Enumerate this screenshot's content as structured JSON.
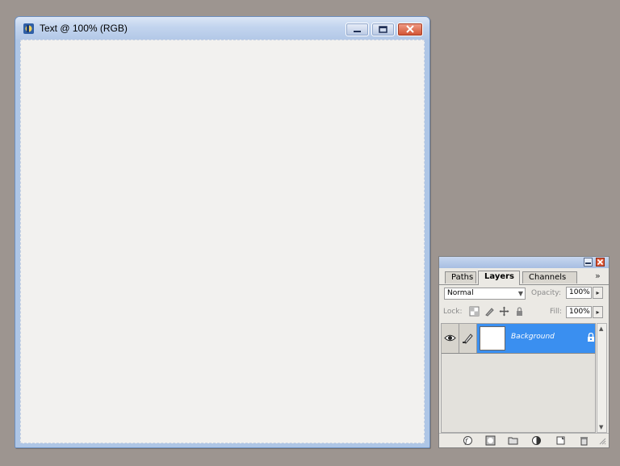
{
  "document_window": {
    "title": "Text @ 100% (RGB)",
    "icons": [
      "photoshop-app-icon",
      "minimize-icon",
      "maximize-icon",
      "close-icon"
    ]
  },
  "layers_palette": {
    "tabs": [
      {
        "label": "Paths",
        "active": false
      },
      {
        "label": "Layers",
        "active": true
      },
      {
        "label": "Channels",
        "active": false
      }
    ],
    "menu_glyph": "»",
    "blend_mode": "Normal",
    "opacity_label": "Opacity:",
    "opacity_value": "100%",
    "lock_label": "Lock:",
    "lock_icons": [
      "lock-transparent-icon",
      "lock-image-icon",
      "lock-position-icon",
      "lock-all-icon"
    ],
    "fill_label": "Fill:",
    "fill_value": "100%",
    "layers": [
      {
        "name": "Background",
        "visible": true,
        "selected": true,
        "locked": true
      }
    ],
    "footer_icons": [
      "layer-style-icon",
      "add-mask-icon",
      "new-group-icon",
      "adjustment-layer-icon",
      "new-layer-icon",
      "delete-layer-icon"
    ],
    "selection_color": "#3a8ff0"
  }
}
